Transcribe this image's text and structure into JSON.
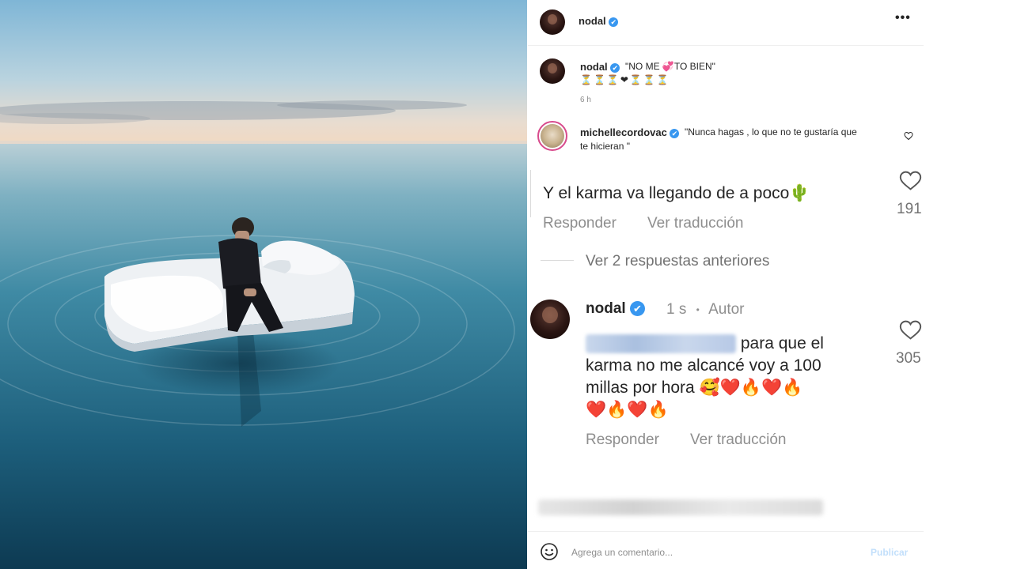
{
  "post": {
    "username": "nodal",
    "menu_icon": "more-horizontal-icon",
    "verified_mark": "✔"
  },
  "caption": {
    "username": "nodal",
    "text": "\"NO ME 💞TO BIEN\"",
    "emoji_line": "⏳⏳⏳❤⏳⏳⏳",
    "time": "6 h"
  },
  "comment_1": {
    "username": "michellecordovac",
    "text_line1": "\"Nunca hagas , lo que no te gustaría que",
    "text_line2": "te hicieran \""
  },
  "comment_2": {
    "text": "Y el karma va llegando de a poco🌵",
    "reply": "Responder",
    "translate": "Ver traducción",
    "likes": "191"
  },
  "view_replies": "Ver 2 respuestas anteriores",
  "comment_3": {
    "username": "nodal",
    "time": "1 s",
    "separator": "•",
    "author_tag": "Autor",
    "text_line1": "para que el",
    "text_line2": "karma no me alcancé voy a 100",
    "text_line3": "millas por hora 🥰❤️🔥❤️🔥",
    "text_line4": "❤️🔥❤️🔥",
    "reply": "Responder",
    "translate": "Ver traducción",
    "likes": "305"
  },
  "input": {
    "placeholder": "Agrega un comentario...",
    "publish": "Publicar"
  },
  "colors": {
    "verified": "#3897f0",
    "muted": "#8e8e8e",
    "text": "#262626"
  }
}
